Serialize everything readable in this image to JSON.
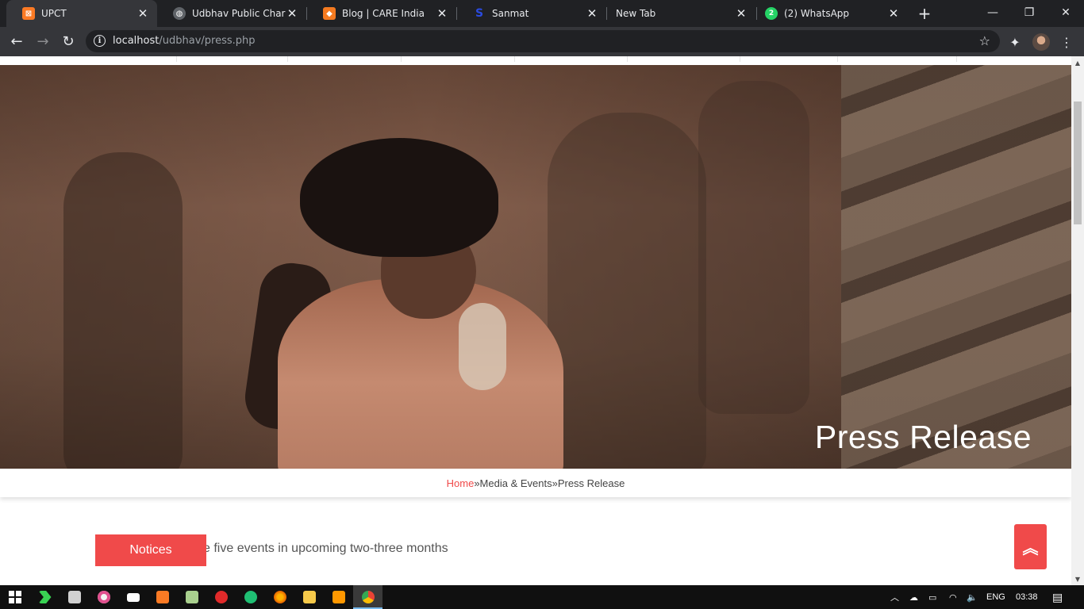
{
  "browser": {
    "tabs": [
      {
        "title": "UPCT",
        "icon": "xampp-icon",
        "color": "#fb7a24",
        "active": true
      },
      {
        "title": "Udbhav Public Charitab",
        "icon": "globe-icon",
        "color": "#9aa0a6",
        "active": false
      },
      {
        "title": "Blog | CARE India",
        "icon": "care-icon",
        "color": "#f47a20",
        "active": false
      },
      {
        "title": "Sanmat",
        "icon": "sanmat-icon",
        "color": "#1a3cc8",
        "active": false
      },
      {
        "title": "New Tab",
        "icon": "",
        "color": "",
        "active": false
      },
      {
        "title": "(2) WhatsApp",
        "icon": "whatsapp-icon",
        "color": "#25d366",
        "active": false
      }
    ],
    "url_host": "localhost",
    "url_path": "/udbhav/press.php"
  },
  "hero": {
    "title": "Press Release"
  },
  "breadcrumb": {
    "home": "Home",
    "sep1": "» ",
    "media": "Media & Events",
    "sep2": " »",
    "current": "Press Release"
  },
  "notices": {
    "label": "Notices",
    "ticker": "e five events in upcoming two-three months"
  },
  "taskbar": {
    "language": "ENG",
    "time": "03:38"
  },
  "colors": {
    "accent": "#f04a4a",
    "tab_bg": "#202124",
    "toolbar_bg": "#35363a"
  }
}
